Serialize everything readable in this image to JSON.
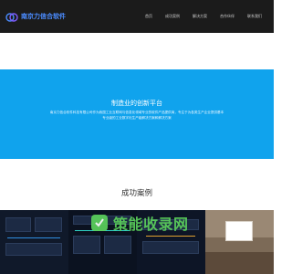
{
  "header": {
    "logo_text": "南京力信合软件",
    "nav": [
      {
        "label": "首页"
      },
      {
        "label": "成功案例"
      },
      {
        "label": "解决方案"
      },
      {
        "label": "合作伙伴"
      },
      {
        "label": "联系我们"
      }
    ]
  },
  "hero": {
    "title": "制造业的创新平台",
    "line1": "南京力信合软件科技有限公司作为我国工业互联网与信息化领域专业的软件产品提供商，专注于为各类生产企业提供基本",
    "line2": "专业级的工业数字化生产级解决方案和解决方案"
  },
  "cases": {
    "title": "成功案例"
  },
  "watermark": {
    "text": "策能收录网"
  },
  "colors": {
    "header_bg": "#1b1b1b",
    "hero_bg": "#10a3ed",
    "logo_text": "#4b8cff",
    "watermark": "#5bd05b"
  }
}
